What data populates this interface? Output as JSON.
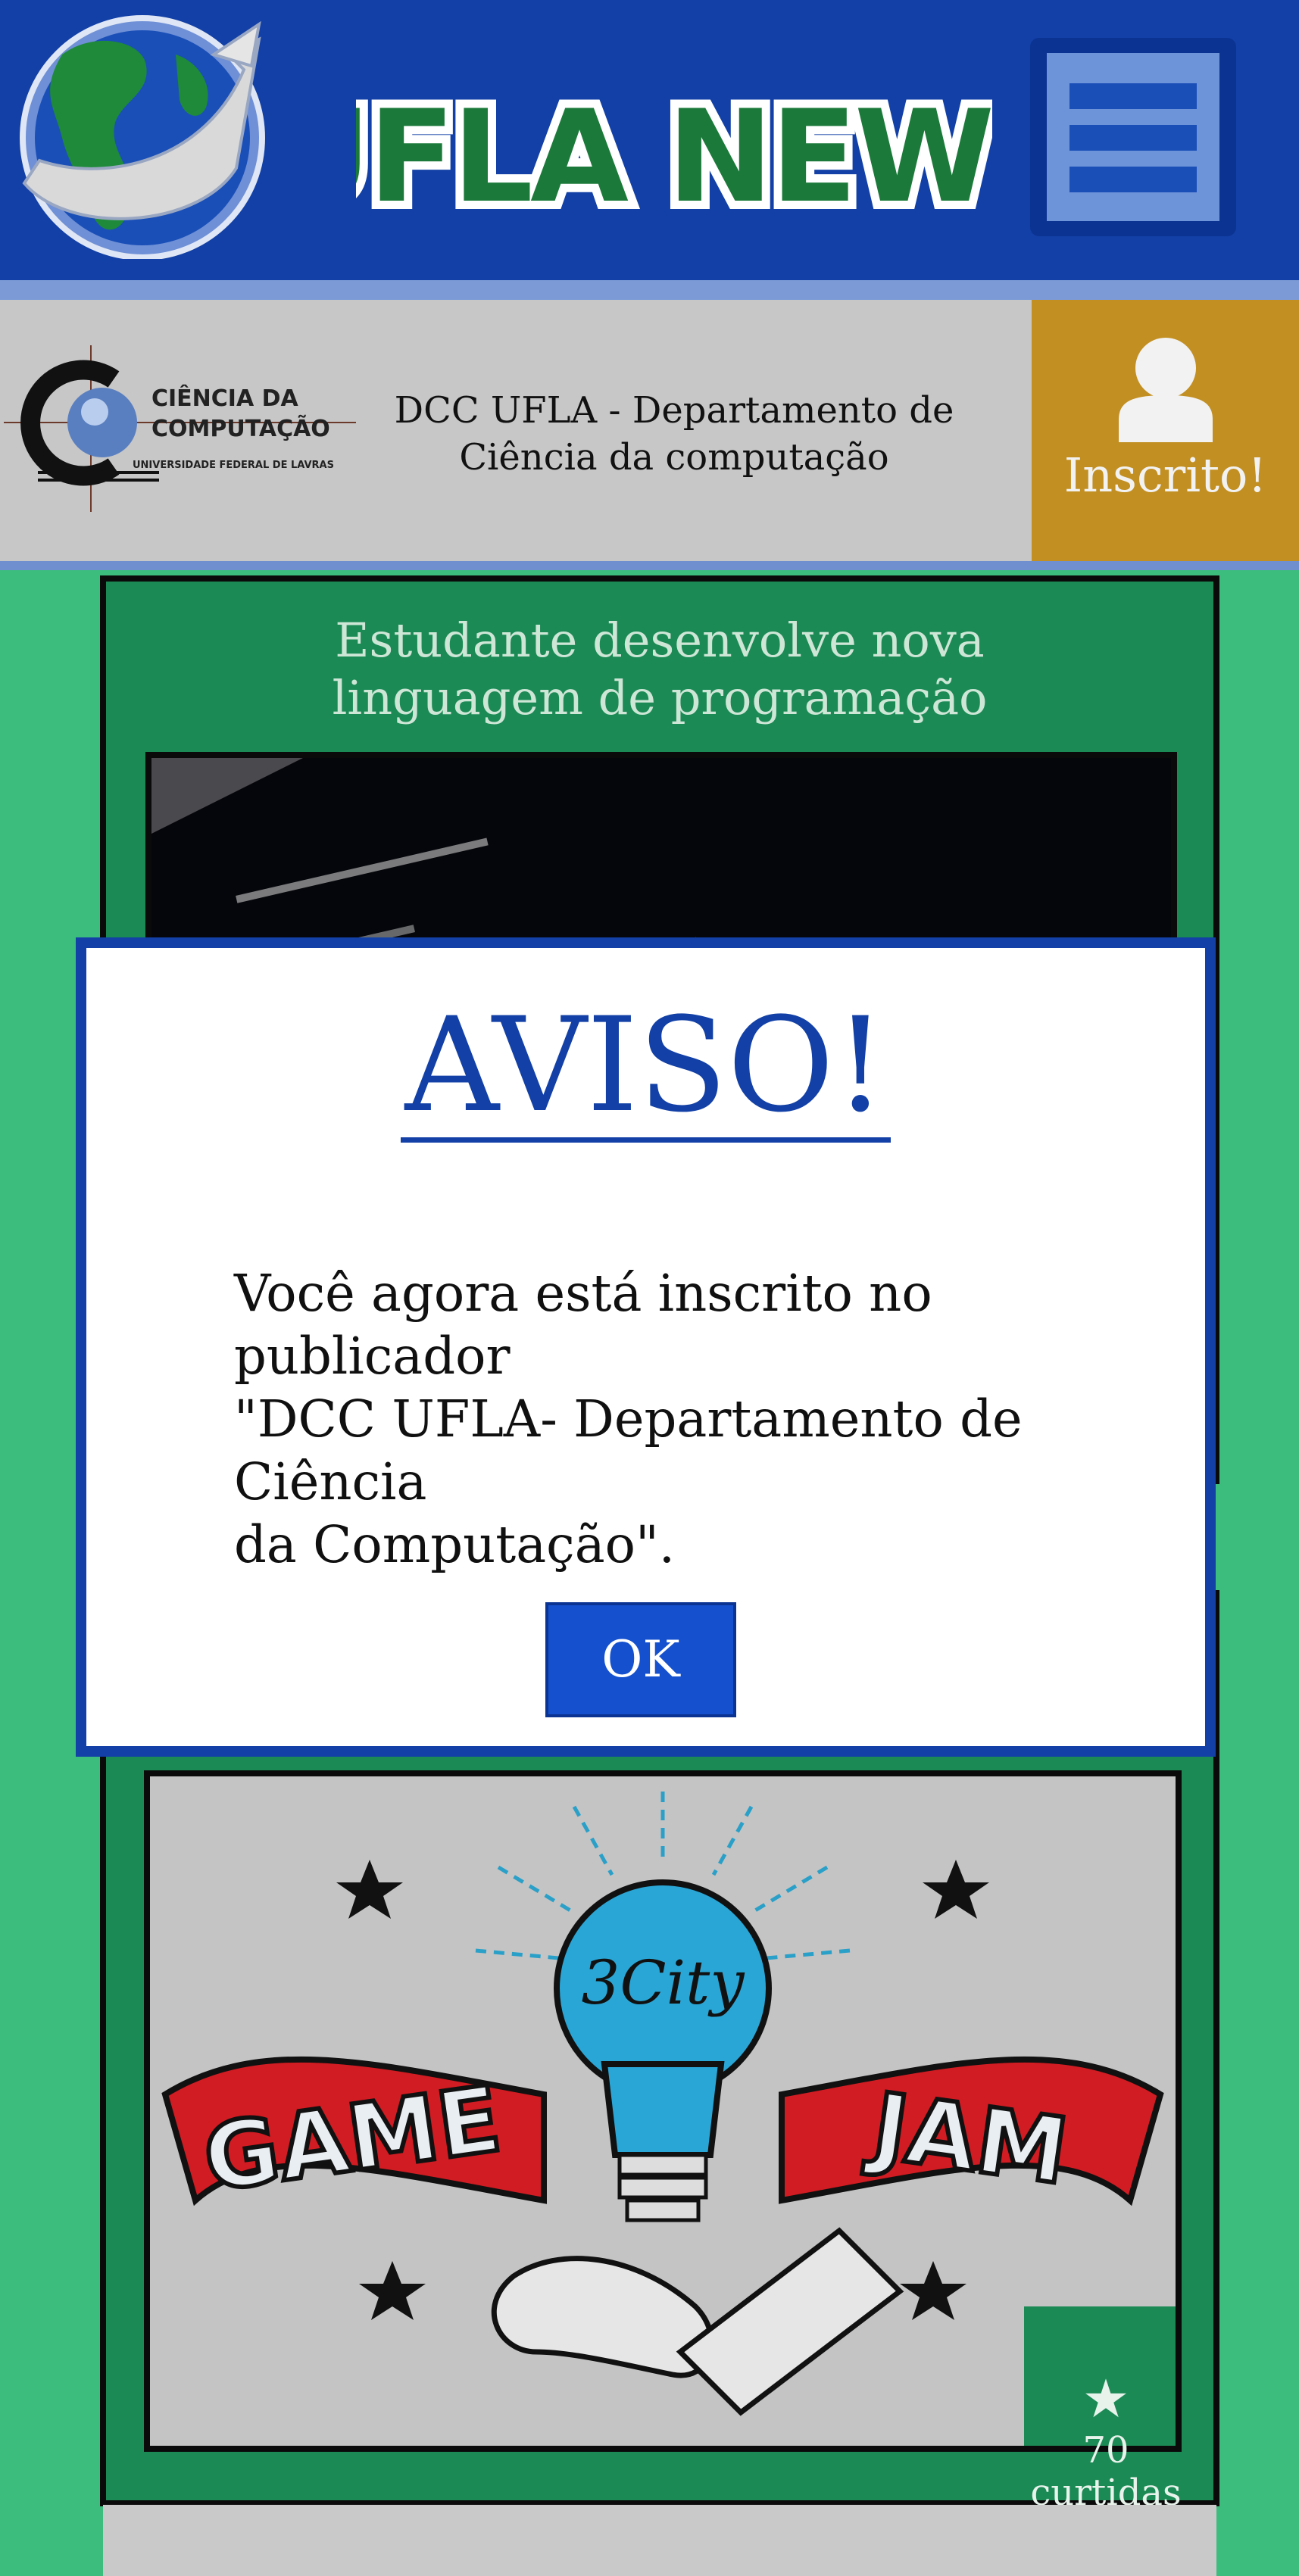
{
  "header": {
    "logo_icon": "globe-arrow-logo",
    "brand_text": "UFLA NEWS",
    "menu_icon": "hamburger-menu-icon"
  },
  "publisher": {
    "logo_title_line1": "CIÊNCIA DA",
    "logo_title_line2": "COMPUTAÇÃO",
    "logo_subtitle": "UNIVERSIDADE FEDERAL DE LAVRAS",
    "name_line1": "DCC UFLA - Departamento de",
    "name_line2": "Ciência da computação",
    "subscribe_label": "Inscrito!",
    "subscribe_icon": "user-icon"
  },
  "feed": {
    "post1": {
      "title_line1": "Estudante desenvolve nova",
      "title_line2": "linguagem de programação",
      "image": "code-screenshot"
    },
    "post2": {
      "image_badge": "3City",
      "image_left_word": "GAME",
      "image_right_word": "JAM",
      "likes_icon": "star-icon",
      "likes": "70 curtidas"
    }
  },
  "modal": {
    "title": "AVISO!",
    "message_line1": "Você agora está inscrito no publicador",
    "message_line2": "\"DCC UFLA- Departamento de Ciência",
    "message_line3": "da Computação\".",
    "ok_label": "OK"
  },
  "colors": {
    "header_blue": "#1240a6",
    "page_green": "#3dbd7d",
    "card_green": "#1b8a55",
    "subscribe_gold": "#c28f22",
    "ok_blue": "#1551cf"
  }
}
